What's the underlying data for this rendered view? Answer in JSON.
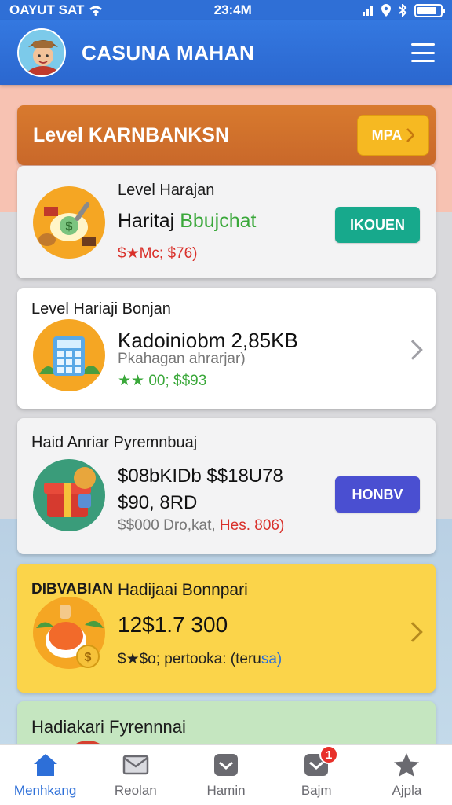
{
  "status": {
    "carrier": "OAYUT SAT",
    "time": "23:4M",
    "battery_level": 0.85
  },
  "appbar": {
    "title": "CASUNA MAHAN"
  },
  "banner": {
    "title": "Level KARNBANKSN",
    "button_label": "MPA"
  },
  "cards": [
    {
      "head": "Level Harajan",
      "main_a": "Haritaj",
      "main_b": "Bbujchat",
      "sub": "$★Mc; $76)",
      "button": "IKOUEN"
    },
    {
      "head": "Level Hariaji Bonjan",
      "main": "Kadoiniobm 2,85KB",
      "sub1": "Pkahagan ahrarjar)",
      "sub2": "★★ 00; $$93"
    },
    {
      "head": "Haid Anriar Pyremnbuaj",
      "main1": "$08bKIDb  $$18U78",
      "main2": "$90, 8RD",
      "sub_a": "$$000 Dro,kat,",
      "sub_b": "Hes. 806)",
      "button": "HONBV"
    },
    {
      "head_badge": "DIBVABIAN",
      "head": "Hadijaai Bonnpari",
      "main": "12$1.7 300",
      "sub_a": "$★$o; pertooka: (teru",
      "sub_b": "sa)"
    },
    {
      "head": "Hadiakari Fyrennnai"
    }
  ],
  "tabs": [
    {
      "label": "Menhkang",
      "icon": "home-icon",
      "active": true
    },
    {
      "label": "Reolan",
      "icon": "mail-icon"
    },
    {
      "label": "Hamin",
      "icon": "message-icon"
    },
    {
      "label": "Bajm",
      "icon": "inbox-icon",
      "badge": "1"
    },
    {
      "label": "Ajpla",
      "icon": "star-icon"
    }
  ],
  "colors": {
    "primary": "#2f6fd6",
    "banner": "#d87a2e",
    "teal": "#17a98c",
    "indigo": "#4a4fd1",
    "yellow_card": "#fbd44a"
  }
}
